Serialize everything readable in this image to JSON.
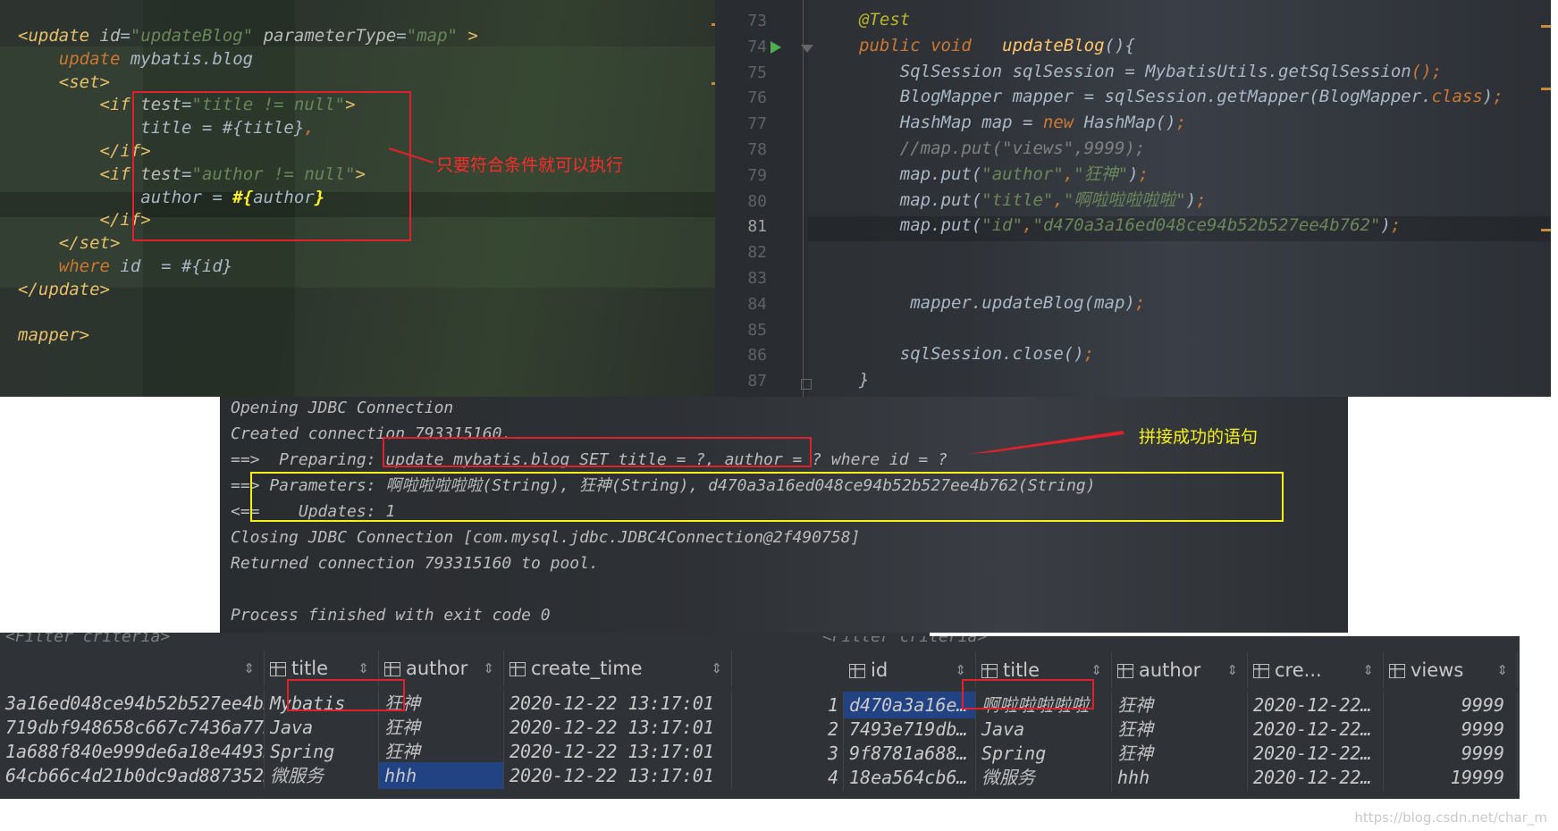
{
  "xml_editor": {
    "lines": [
      [
        [
          "c-tag",
          "<update "
        ],
        [
          "c-attr",
          "id"
        ],
        [
          "c-txt",
          "="
        ],
        [
          "c-str",
          "\"updateBlog\""
        ],
        [
          "c-attr",
          " parameterType"
        ],
        [
          "c-txt",
          "="
        ],
        [
          "c-str",
          "\"map\""
        ],
        [
          "c-tag",
          " >"
        ]
      ],
      [
        [
          "c-txt",
          "    "
        ],
        [
          "c-kw",
          "update"
        ],
        [
          "c-txt",
          " mybatis.blog"
        ]
      ],
      [
        [
          "c-txt",
          "    "
        ],
        [
          "c-tag",
          "<set>"
        ]
      ],
      [
        [
          "c-txt",
          "        "
        ],
        [
          "c-tag",
          "<if "
        ],
        [
          "c-attr",
          "test"
        ],
        [
          "c-txt",
          "="
        ],
        [
          "c-str",
          "\"title != null\""
        ],
        [
          "c-tag",
          ">"
        ]
      ],
      [
        [
          "c-txt",
          "            title = #{title}"
        ],
        [
          "c-kw",
          ","
        ]
      ],
      [
        [
          "c-txt",
          "        "
        ],
        [
          "c-tag",
          "</if>"
        ]
      ],
      [
        [
          "c-txt",
          "        "
        ],
        [
          "c-tag",
          "<if "
        ],
        [
          "c-attr",
          "test"
        ],
        [
          "c-txt",
          "="
        ],
        [
          "c-str",
          "\"author != null\""
        ],
        [
          "c-tag",
          ">"
        ]
      ],
      [
        [
          "c-txt",
          "            author = "
        ],
        [
          "c-hl",
          "#{"
        ],
        [
          "c-txt",
          "author"
        ],
        [
          "c-hl",
          "}"
        ]
      ],
      [
        [
          "c-txt",
          "        "
        ],
        [
          "c-tag",
          "</if>"
        ]
      ],
      [
        [
          "c-txt",
          "    "
        ],
        [
          "c-tag",
          "</set>"
        ]
      ],
      [
        [
          "c-txt",
          "    "
        ],
        [
          "c-kw",
          "where"
        ],
        [
          "c-txt",
          " id  = #{id}"
        ]
      ],
      [
        [
          "c-tag",
          "</update>"
        ]
      ],
      [
        [
          "c-txt",
          ""
        ]
      ],
      [
        [
          "c-tag",
          "mapper>"
        ]
      ]
    ],
    "annotation": "只要符合条件就可以执行"
  },
  "java_editor": {
    "line_numbers": [
      "73",
      "74",
      "75",
      "76",
      "77",
      "78",
      "79",
      "80",
      "81",
      "82",
      "83",
      "84",
      "85",
      "86",
      "87"
    ],
    "current_line": "81",
    "lines": [
      [
        [
          "c-ann",
          "@Test"
        ]
      ],
      [
        [
          "c-kw",
          "public void"
        ],
        [
          "c-txt",
          "   "
        ],
        [
          "c-fn",
          "updateBlog"
        ],
        [
          "c-txt",
          "(){"
        ]
      ],
      [
        [
          "c-txt",
          "    SqlSession sqlSession = MybatisUtils."
        ],
        [
          "c-txt",
          "getSqlSession"
        ],
        [
          "c-kw",
          "();"
        ]
      ],
      [
        [
          "c-txt",
          "    BlogMapper mapper = sqlSession.getMapper(BlogMapper."
        ],
        [
          "c-kw",
          "class"
        ],
        [
          "c-txt",
          ")"
        ],
        [
          "c-kw",
          ";"
        ]
      ],
      [
        [
          "c-txt",
          "    HashMap map = "
        ],
        [
          "c-kw",
          "new"
        ],
        [
          "c-txt",
          " HashMap()"
        ],
        [
          "c-kw",
          ";"
        ]
      ],
      [
        [
          "c-cm",
          "    //map.put(\"views\",9999);"
        ]
      ],
      [
        [
          "c-txt",
          "    map.put("
        ],
        [
          "c-str",
          "\"author\""
        ],
        [
          "c-kw",
          ","
        ],
        [
          "c-str",
          "\"狂神\""
        ],
        [
          "c-txt",
          ")"
        ],
        [
          "c-kw",
          ";"
        ]
      ],
      [
        [
          "c-txt",
          "    map.put("
        ],
        [
          "c-str",
          "\"title\""
        ],
        [
          "c-kw",
          ","
        ],
        [
          "c-str",
          "\"啊啦啦啦啦啦\""
        ],
        [
          "c-txt",
          ")"
        ],
        [
          "c-kw",
          ";"
        ]
      ],
      [
        [
          "c-txt",
          "    map.put("
        ],
        [
          "c-str",
          "\"id\""
        ],
        [
          "c-kw",
          ","
        ],
        [
          "c-str",
          "\"d470a3a16ed048ce94b52b527ee4b762\""
        ],
        [
          "c-txt",
          ")"
        ],
        [
          "c-kw",
          ";"
        ]
      ],
      [
        [
          "c-txt",
          ""
        ]
      ],
      [
        [
          "c-txt",
          ""
        ]
      ],
      [
        [
          "c-txt",
          "     mapper.updateBlog(map)"
        ],
        [
          "c-kw",
          ";"
        ]
      ],
      [
        [
          "c-txt",
          ""
        ]
      ],
      [
        [
          "c-txt",
          "    sqlSession.close()"
        ],
        [
          "c-kw",
          ";"
        ]
      ],
      [
        [
          "c-txt",
          "}"
        ]
      ]
    ]
  },
  "console": {
    "lines": [
      "Opening JDBC Connection",
      "Created connection 793315160.",
      "==>  Preparing: update mybatis.blog SET title = ?, author = ? where id = ?",
      "==> Parameters: 啊啦啦啦啦啦(String), 狂神(String), d470a3a16ed048ce94b52b527ee4b762(String)",
      "<==    Updates: 1",
      "Closing JDBC Connection [com.mysql.jdbc.JDBC4Connection@2f490758]",
      "Returned connection 793315160 to pool.",
      "",
      "Process finished with exit code 0"
    ],
    "annotation": "拼接成功的语句"
  },
  "grid_left": {
    "filter_placeholder": "<Filter criteria>",
    "columns": [
      "",
      "title",
      "author",
      "create_time"
    ],
    "rows": [
      [
        "3a16ed048ce94b52b527ee4b…",
        "Mybatis",
        "狂神",
        "2020-12-22 13:17:01"
      ],
      [
        "719dbf948658c667c7436a77…",
        "Java",
        "狂神",
        "2020-12-22 13:17:01"
      ],
      [
        "1a688f840e999de6a18e4493…",
        "Spring",
        "狂神",
        "2020-12-22 13:17:01"
      ],
      [
        "64cb66c4d21b0dc9ad887352…",
        "微服务",
        "hhh",
        "2020-12-22 13:17:01"
      ]
    ]
  },
  "grid_right": {
    "filter_placeholder": "<Filter criteria>",
    "row_markers": [
      "1",
      "2",
      "3",
      "4"
    ],
    "columns": [
      "id",
      "title",
      "author",
      "cre...",
      "views"
    ],
    "rows": [
      [
        "d470a3a16e…",
        "啊啦啦啦啦啦",
        "狂神",
        "2020-12-22…",
        "9999"
      ],
      [
        "7493e719db…",
        "Java",
        "狂神",
        "2020-12-22…",
        "9999"
      ],
      [
        "9f8781a688…",
        "Spring",
        "狂神",
        "2020-12-22…",
        "9999"
      ],
      [
        "18ea564cb6…",
        "微服务",
        "hhh",
        "2020-12-22…",
        "19999"
      ]
    ]
  },
  "watermark": "https://blog.csdn.net/char_m",
  "colors": {
    "highlight_box": "#e0202a",
    "console_box": "#f5f01a",
    "selection": "#214283"
  }
}
